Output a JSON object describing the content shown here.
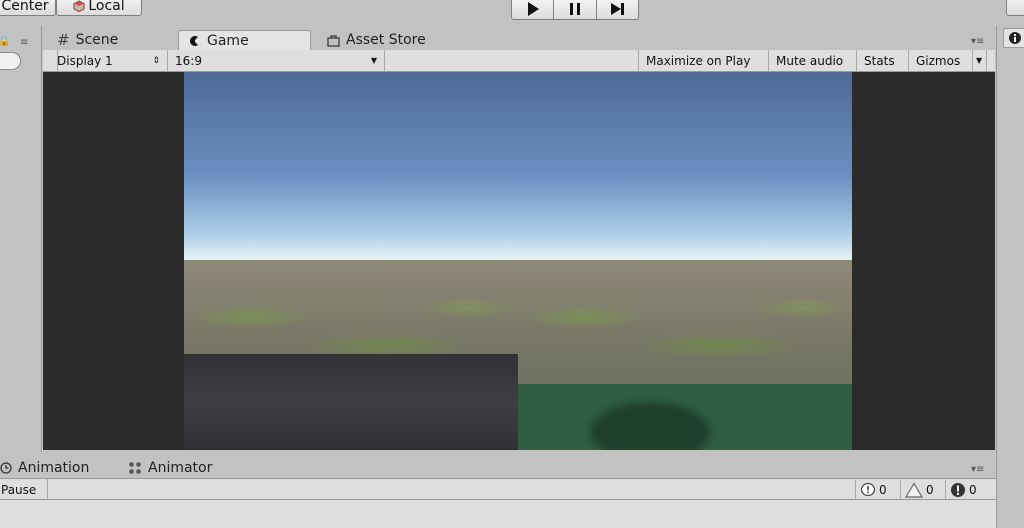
{
  "toolbar": {
    "center_label": "Center",
    "local_label": "Local",
    "play_icons": [
      "play-icon",
      "pause-icon",
      "step-icon"
    ]
  },
  "tabs": [
    {
      "label": "Scene",
      "icon": "scene-icon"
    },
    {
      "label": "Game",
      "icon": "game-icon",
      "active": true
    },
    {
      "label": "Asset Store",
      "icon": "asset-store-icon"
    }
  ],
  "game_toolbar": {
    "display": "Display 1",
    "aspect": "16:9",
    "maximize": "Maximize on Play",
    "mute": "Mute audio",
    "stats": "Stats",
    "gizmos": "Gizmos"
  },
  "bottom_tabs": [
    {
      "label": "Animation",
      "icon": "clock-icon"
    },
    {
      "label": "Animator",
      "icon": "animator-icon"
    }
  ],
  "console": {
    "pause_label": "Pause",
    "info_count": "0",
    "warning_count": "0",
    "error_count": "0"
  },
  "colors": {
    "panel_bg": "#c2c2c2",
    "toolbar_bg": "#dedede",
    "viewport_bg": "#2b2b2b"
  }
}
